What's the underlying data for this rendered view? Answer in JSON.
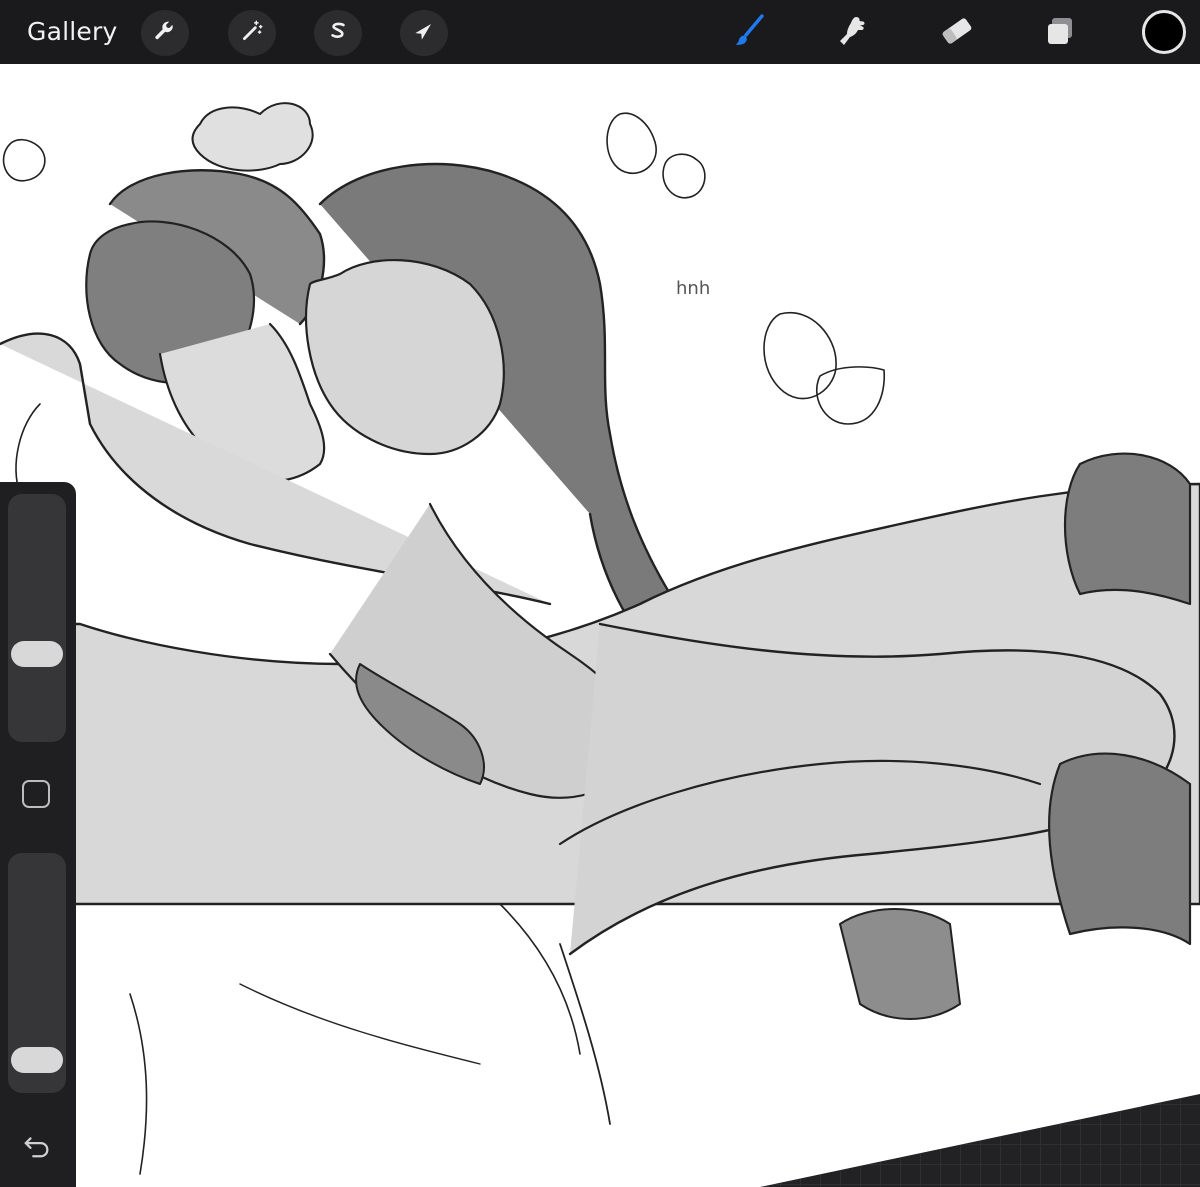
{
  "topbar": {
    "gallery_label": "Gallery",
    "left_tools": [
      "wrench-icon",
      "magic-wand-icon",
      "selection-s-icon",
      "transform-arrow-icon"
    ],
    "right_tools": [
      "brush-icon",
      "smudge-icon",
      "eraser-icon",
      "layers-icon"
    ],
    "active_tool": "brush",
    "accent_color": "#1f7af0",
    "current_color": "#000000"
  },
  "sidebar": {
    "brush_size_level": 0.33,
    "opacity_level": 0.0,
    "modify_icon": "square-modify-icon",
    "undo_icon": "undo-arrow-icon"
  },
  "canvas": {
    "sketch_note": "hnh"
  }
}
